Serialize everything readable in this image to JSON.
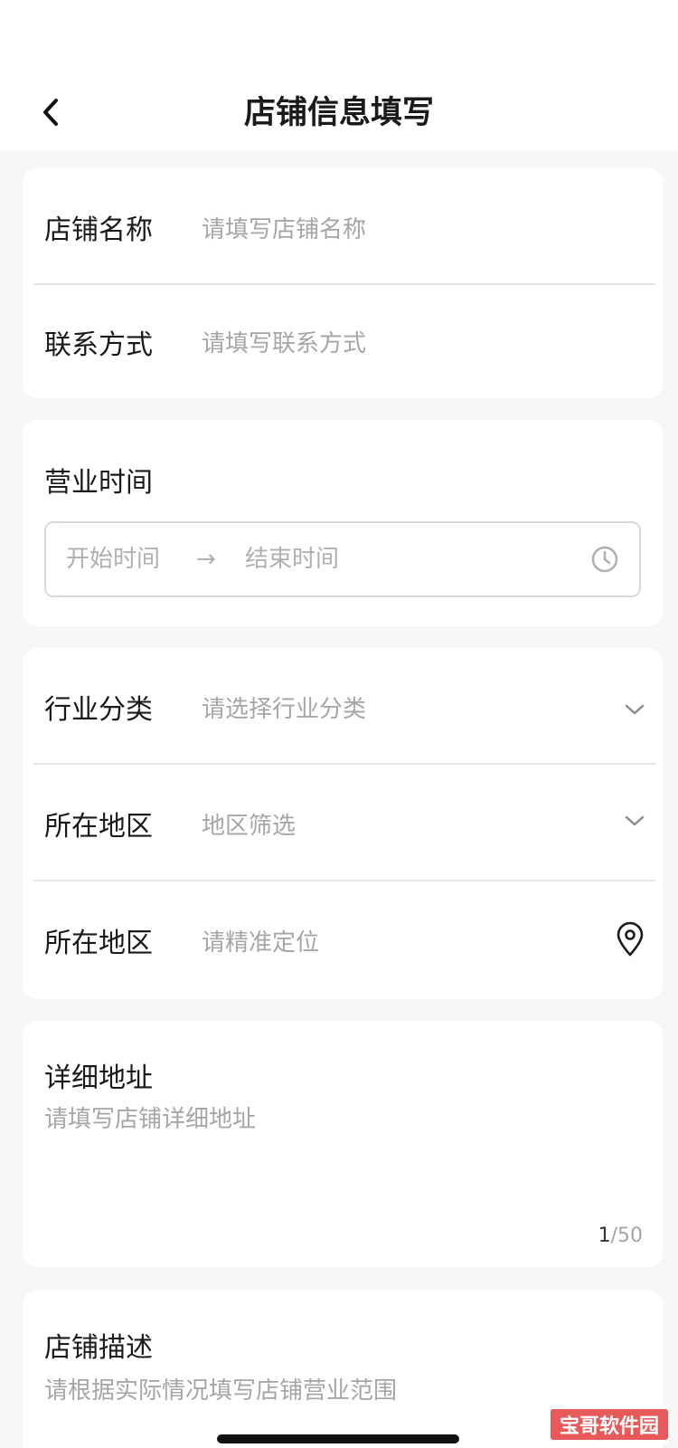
{
  "header": {
    "title": "店铺信息填写",
    "back_icon": "chevron-left-icon"
  },
  "basic": {
    "shop_name": {
      "label": "店铺名称",
      "placeholder": "请填写店铺名称"
    },
    "contact": {
      "label": "联系方式",
      "placeholder": "请填写联系方式"
    }
  },
  "hours": {
    "label": "营业时间",
    "start_placeholder": "开始时间",
    "arrow": "→",
    "end_placeholder": "结束时间",
    "icon": "clock-icon"
  },
  "category": {
    "industry": {
      "label": "行业分类",
      "placeholder": "请选择行业分类",
      "icon": "chevron-down-icon"
    },
    "region": {
      "label": "所在地区",
      "placeholder": "地区筛选",
      "icon": "chevron-down-icon"
    },
    "location": {
      "label": "所在地区",
      "placeholder": "请精准定位",
      "icon": "location-pin-icon"
    }
  },
  "address": {
    "label": "详细地址",
    "placeholder": "请填写店铺详细地址",
    "count_current": "1",
    "count_max": "/50"
  },
  "description": {
    "label": "店铺描述",
    "placeholder": "请根据实际情况填写店铺营业范围"
  },
  "watermark": {
    "text": "宝哥软件园"
  }
}
